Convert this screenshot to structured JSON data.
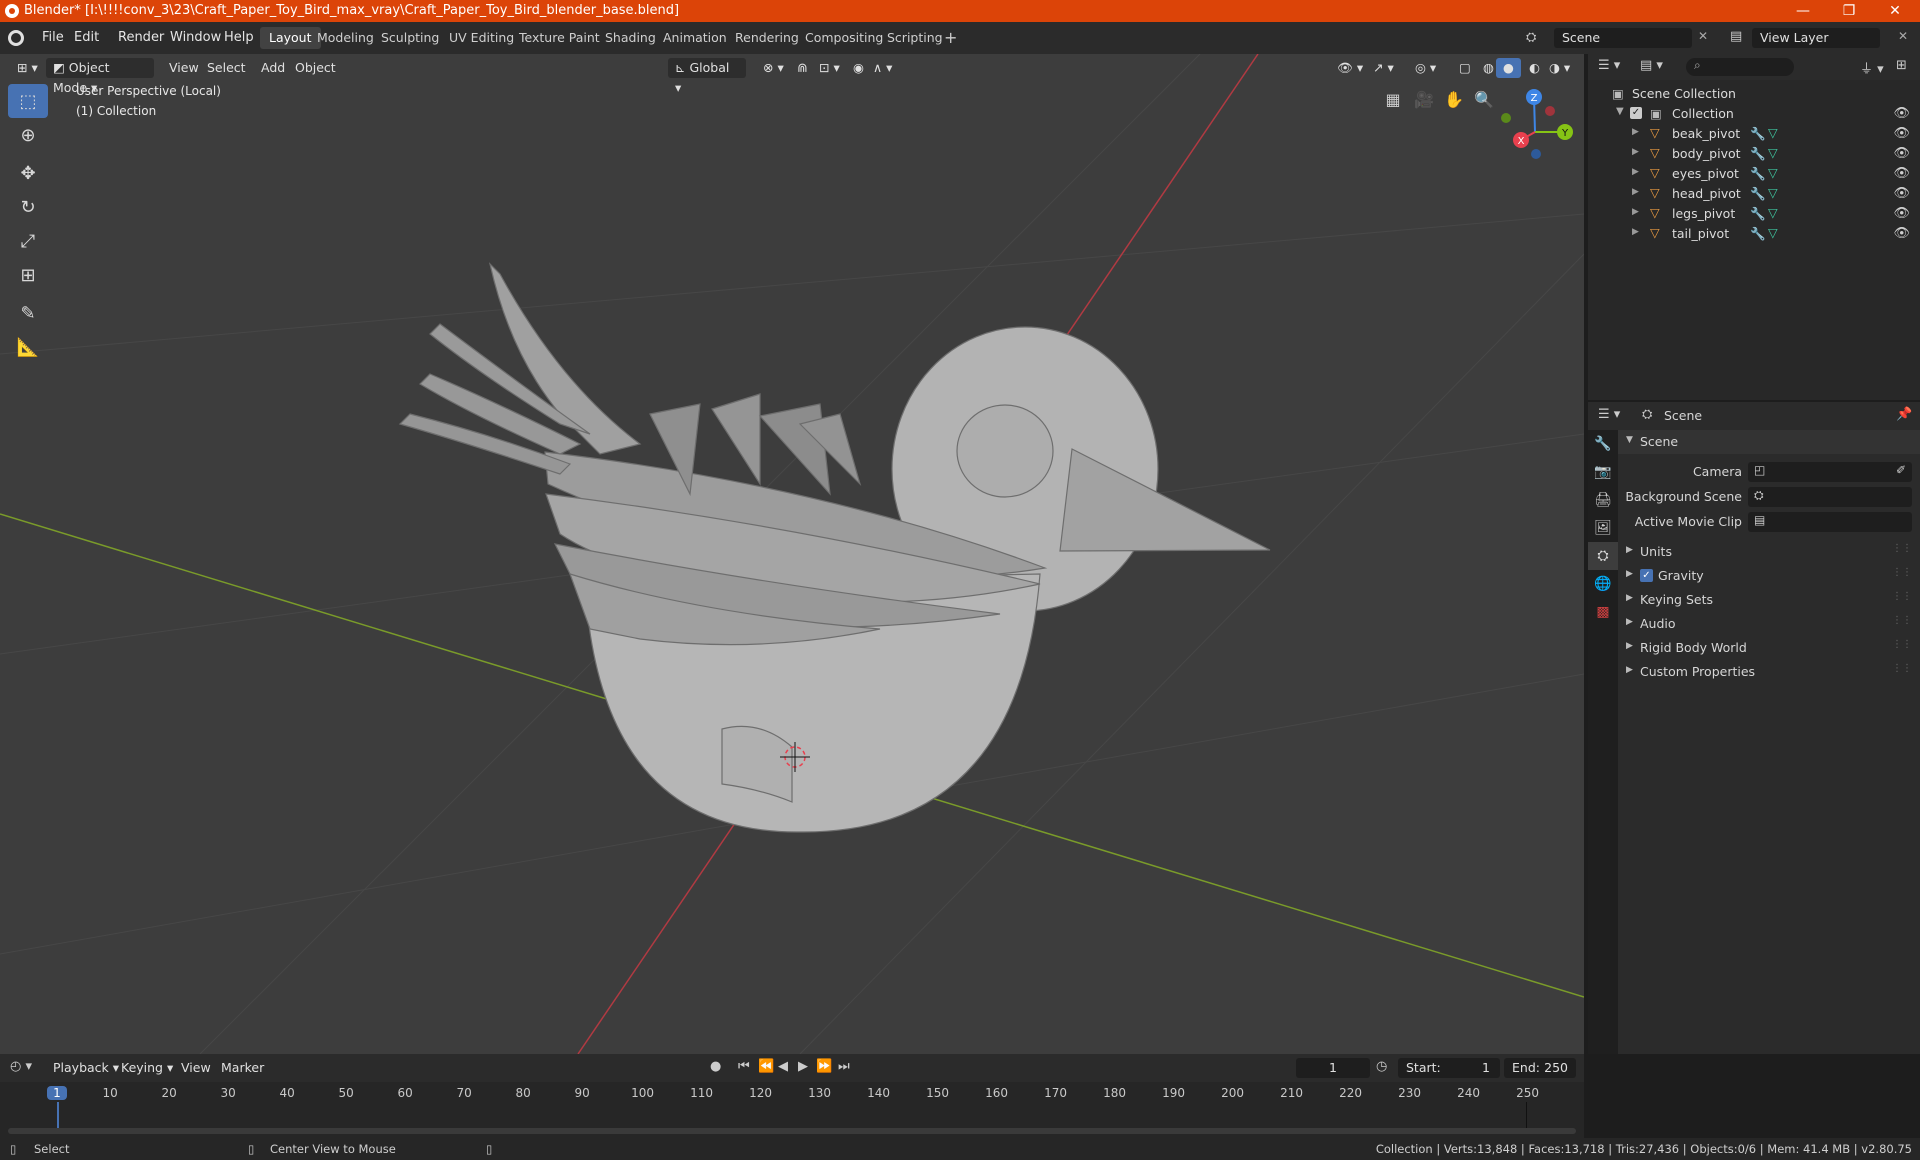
{
  "window": {
    "title": "Blender* [I:\\!!!!conv_3\\23\\Craft_Paper_Toy_Bird_max_vray\\Craft_Paper_Toy_Bird_blender_base.blend]",
    "minimize": "—",
    "maximize": "❐",
    "close": "✕"
  },
  "menu": [
    "File",
    "Edit",
    "Render",
    "Window",
    "Help"
  ],
  "workspaces": [
    "Layout",
    "Modeling",
    "Sculpting",
    "UV Editing",
    "Texture Paint",
    "Shading",
    "Animation",
    "Rendering",
    "Compositing",
    "Scripting"
  ],
  "active_workspace": "Layout",
  "scene_field": "Scene",
  "view_layer_field": "View Layer",
  "viewport": {
    "mode": "Object Mode",
    "menus": [
      "View",
      "Select",
      "Add",
      "Object"
    ],
    "orientation": "Global",
    "overlay_text_1": "User Perspective (Local)",
    "overlay_text_2": "(1) Collection",
    "gizmo": {
      "x": "X",
      "y": "Y",
      "z": "Z"
    }
  },
  "outliner": {
    "root": "Scene Collection",
    "collection": "Collection",
    "items": [
      "beak_pivot",
      "body_pivot",
      "eyes_pivot",
      "head_pivot",
      "legs_pivot",
      "tail_pivot"
    ]
  },
  "properties": {
    "header": "Scene",
    "panel": "Scene",
    "fields": [
      {
        "label": "Camera"
      },
      {
        "label": "Background Scene"
      },
      {
        "label": "Active Movie Clip"
      }
    ],
    "sections": [
      "Units",
      "Gravity",
      "Keying Sets",
      "Audio",
      "Rigid Body World",
      "Custom Properties"
    ],
    "gravity_checked": true
  },
  "timeline": {
    "menus": [
      "Playback",
      "Keying",
      "View",
      "Marker"
    ],
    "current_frame": "1",
    "start_label": "Start:",
    "start": "1",
    "end_label": "End:",
    "end": "250",
    "ticks": [
      "1",
      "10",
      "20",
      "30",
      "40",
      "50",
      "60",
      "70",
      "80",
      "90",
      "100",
      "110",
      "120",
      "130",
      "140",
      "150",
      "160",
      "170",
      "180",
      "190",
      "200",
      "210",
      "220",
      "230",
      "240",
      "250"
    ]
  },
  "status": {
    "left": "Select",
    "middle": "Center View to Mouse",
    "right": "Collection | Verts:13,848 | Faces:13,718 | Tris:27,436 | Objects:0/6 | Mem: 41.4 MB | v2.80.75"
  },
  "colors": {
    "titlebar": "#dc4408",
    "accent": "#4772b3",
    "x_axis": "#e8404e",
    "y_axis": "#86c415",
    "z_axis": "#3e86e6",
    "object_icon": "#e89a42"
  }
}
